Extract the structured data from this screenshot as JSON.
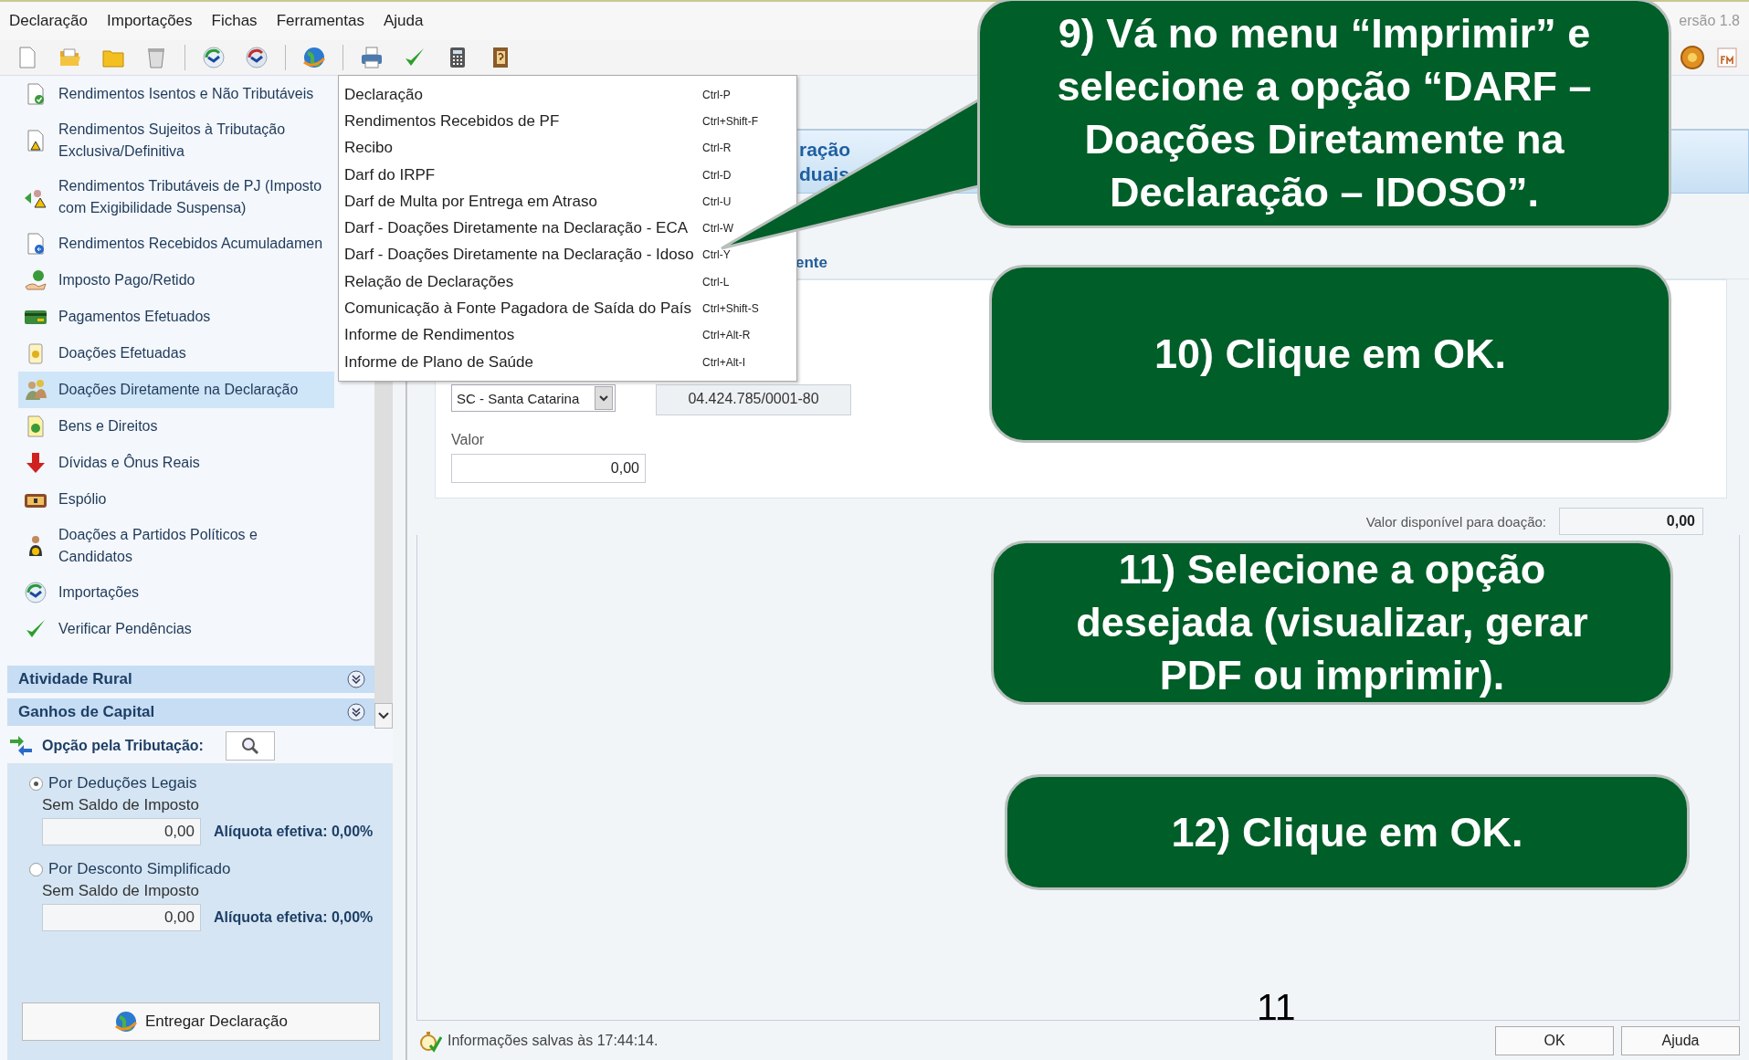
{
  "menu_bar": {
    "items": [
      "Declaração",
      "Importações",
      "Fichas",
      "Ferramentas",
      "Ajuda"
    ],
    "version": "ersão 1.8"
  },
  "sidebar": {
    "items": [
      {
        "label": "Rendimentos Isentos e Não Tributáveis",
        "selected": false
      },
      {
        "label": "Rendimentos Sujeitos à Tributação Exclusiva/Definitiva",
        "selected": false
      },
      {
        "label": "Rendimentos Tributáveis de PJ (Imposto com Exigibilidade Suspensa)",
        "selected": false
      },
      {
        "label": "Rendimentos Recebidos Acumuladamen",
        "selected": false
      },
      {
        "label": "Imposto Pago/Retido",
        "selected": false
      },
      {
        "label": "Pagamentos Efetuados",
        "selected": false
      },
      {
        "label": "Doações Efetuadas",
        "selected": false
      },
      {
        "label": "Doações Diretamente na Declaração",
        "selected": true
      },
      {
        "label": "Bens e Direitos",
        "selected": false
      },
      {
        "label": "Dívidas e Ônus Reais",
        "selected": false
      },
      {
        "label": "Espólio",
        "selected": false
      },
      {
        "label": "Doações a Partidos Políticos e Candidatos",
        "selected": false
      },
      {
        "label": "Importações",
        "selected": false
      },
      {
        "label": "Verificar Pendências",
        "selected": false
      }
    ],
    "sections": [
      "Atividade Rural",
      "Ganhos de Capital"
    ]
  },
  "taxation": {
    "title": "Opção pela Tributação:",
    "options": [
      {
        "label": "Por Deduções Legais",
        "selected": true,
        "sublabel": "Sem Saldo de Imposto",
        "value": "0,00",
        "rate": "Alíquota efetiva: 0,00%"
      },
      {
        "label": "Por Desconto Simplificado",
        "selected": false,
        "sublabel": "Sem Saldo de Imposto",
        "value": "0,00",
        "rate": "Alíquota efetiva: 0,00%"
      }
    ]
  },
  "deliver_button": "Entregar Declaração",
  "print_menu": {
    "items": [
      {
        "label": "Declaração",
        "shortcut": "Ctrl-P"
      },
      {
        "label": "Rendimentos Recebidos de PF",
        "shortcut": "Ctrl+Shift-F"
      },
      {
        "label": "Recibo",
        "shortcut": "Ctrl-R"
      },
      {
        "label": "Darf do IRPF",
        "shortcut": "Ctrl-D"
      },
      {
        "label": "Darf de Multa por Entrega em Atraso",
        "shortcut": "Ctrl-U"
      },
      {
        "label": "Darf - Doações Diretamente na Declaração - ECA",
        "shortcut": "Ctrl-W"
      },
      {
        "label": "Darf - Doações Diretamente na Declaração - Idoso",
        "shortcut": "Ctrl-Y"
      },
      {
        "label": "Relação de Declarações",
        "shortcut": "Ctrl-L"
      },
      {
        "label": "Comunicação à Fonte Pagadora de Saída do País",
        "shortcut": "Ctrl+Shift-S"
      },
      {
        "label": "Informe de Rendimentos",
        "shortcut": "Ctrl+Alt-R"
      },
      {
        "label": "Informe de Plano de Saúde",
        "shortcut": "Ctrl+Alt-I"
      }
    ]
  },
  "form": {
    "banner": [
      "ração",
      "duais"
    ],
    "section_title": "ente",
    "uf": "SC - Santa Catarina",
    "cnpj": "04.424.785/0001-80",
    "value_label": "Valor",
    "value": "0,00",
    "available_label": "Valor disponível para doação:",
    "available_value": "0,00"
  },
  "status_bar": {
    "message": "Informações salvas às 17:44:14.",
    "buttons": [
      "OK",
      "Ajuda"
    ]
  },
  "callouts": [
    "9) Vá no menu “Imprimir” e\nselecione a opção “DARF –\nDoações Diretamente na\nDeclaração – IDOSO”.",
    "10) Clique em OK.",
    "11) Selecione a opção\ndesejada (visualizar, gerar\nPDF ou imprimir).",
    "12) Clique em OK."
  ],
  "page_number": "11"
}
